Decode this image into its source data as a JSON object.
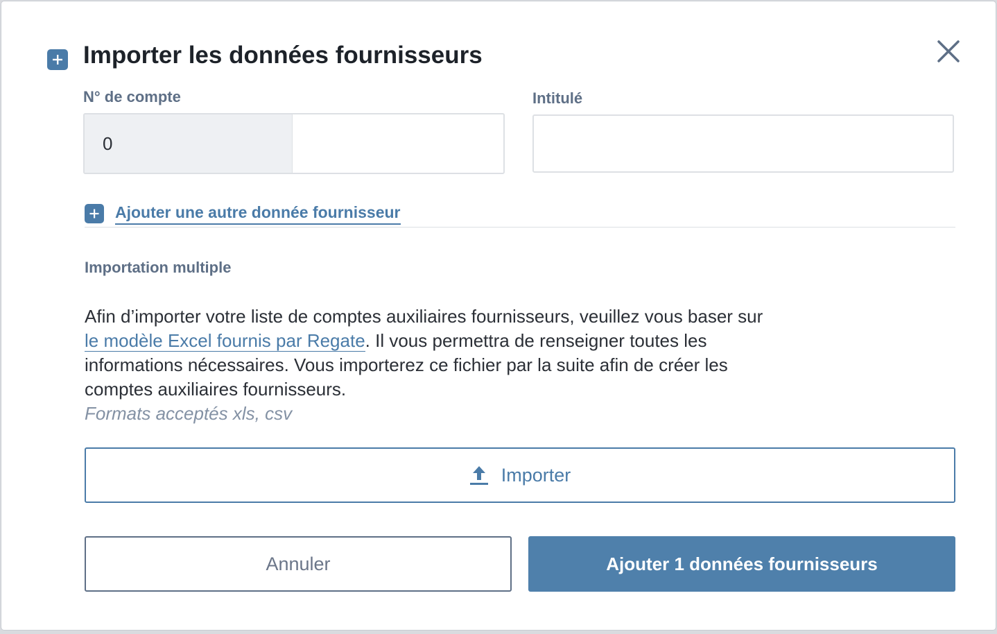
{
  "dialog": {
    "title": "Importer les données fournisseurs",
    "title_icon": "plus-square-icon",
    "close_icon": "close-icon"
  },
  "fields": {
    "account": {
      "label": "N° de compte",
      "prefix": "0",
      "value": ""
    },
    "name": {
      "label": "Intitulé",
      "value": ""
    }
  },
  "add_link": {
    "icon": "plus-square-icon",
    "label": "Ajouter une autre donnée fournisseur"
  },
  "multi_import": {
    "label": "Importation multiple",
    "text_before": "Afin d’importer votre liste de comptes auxiliaires fournisseurs, veuillez vous baser sur ",
    "link": "le modèle Excel fournis par Regate",
    "text_after": ". Il vous permettra de renseigner toutes les informations nécessaires. Vous importerez ce fichier par la suite afin de créer les comptes auxiliaires fournisseurs.",
    "formats": "Formats acceptés xls, csv"
  },
  "import_button": {
    "icon": "upload-icon",
    "label": "Importer"
  },
  "actions": {
    "cancel": "Annuler",
    "submit": "Ajouter 1 données fournisseurs"
  },
  "colors": {
    "accent": "#4a7ba8",
    "label": "#5e6f86",
    "text": "#2b2f36",
    "muted": "#8391a4"
  }
}
